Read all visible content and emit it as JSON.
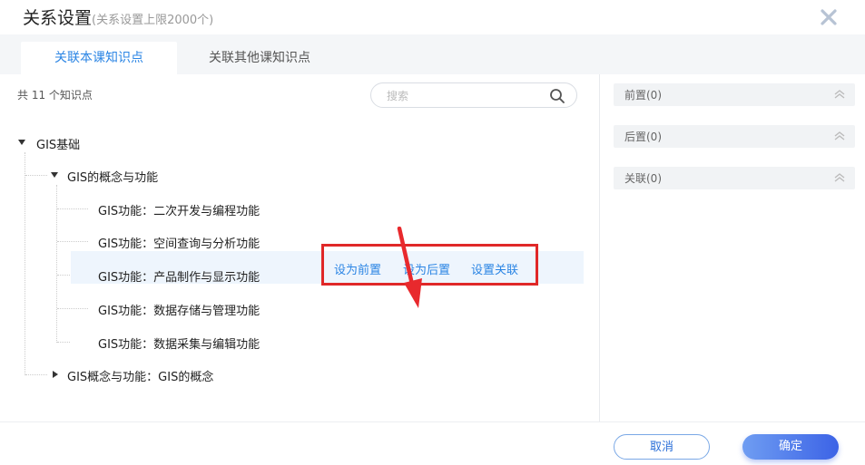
{
  "dialog": {
    "title": "关系设置",
    "subtitle": "(关系设置上限2000个)",
    "close_icon": "close-icon"
  },
  "tabs": [
    {
      "label": "关联本课知识点",
      "active": true
    },
    {
      "label": "关联其他课知识点",
      "active": false
    }
  ],
  "left_panel": {
    "count_text": "共 11 个知识点",
    "search": {
      "placeholder": "搜索",
      "value": "",
      "icon": "search-icon"
    }
  },
  "tree": {
    "root": {
      "label": "GIS基础",
      "expanded": true
    },
    "child1": {
      "label": "GIS的概念与功能",
      "expanded": true
    },
    "leaves": [
      {
        "label": "GIS功能：二次开发与编程功能"
      },
      {
        "label": "GIS功能：空间查询与分析功能"
      },
      {
        "label": "GIS功能：产品制作与显示功能"
      },
      {
        "label": "GIS功能：数据存储与管理功能"
      },
      {
        "label": "GIS功能：数据采集与编辑功能",
        "hovered": true
      }
    ],
    "child2": {
      "label": "GIS概念与功能：GIS的概念",
      "expanded": false
    }
  },
  "row_actions": {
    "set_pre": "设为前置",
    "set_post": "设为后置",
    "set_link": "设置关联"
  },
  "right_panel": {
    "items": [
      {
        "label": "前置(0)"
      },
      {
        "label": "后置(0)"
      },
      {
        "label": "关联(0)"
      }
    ],
    "collapse_icon": "double-chevron-up-icon"
  },
  "footer": {
    "cancel_label": "取消",
    "ok_label": "确定"
  },
  "colors": {
    "accent": "#2b85e4",
    "highlight_box": "#e02828",
    "hover_row": "#eef5fd",
    "ok_button_start": "#6f9df2",
    "ok_button_end": "#3c63e6"
  }
}
